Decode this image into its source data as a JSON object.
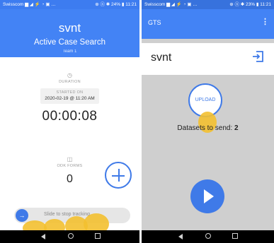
{
  "left": {
    "statusbar": {
      "carrier": "Swisscom",
      "icons": "▆ ◢ ⚡ ◔ ▣ …",
      "right": "⊕ ⓝ ✱ 24% ▮ 11:21"
    },
    "header": {
      "title": "svnt",
      "subtitle": "Active Case Search",
      "team": "Team 1"
    },
    "duration_icon": "◷",
    "duration_label": "DURATION",
    "started_label": "STARTED ON",
    "started_value": "2020-02-19 @ 11:20 AM",
    "timer": "00:00:08",
    "forms_icon": "◫",
    "forms_label": "ODK FORMS",
    "forms_count": "0",
    "fab_label": "+",
    "slider_arrow": "→",
    "slider_text": "Slide to stop tracking"
  },
  "right": {
    "statusbar": {
      "carrier": "Swisscom",
      "icons": "▆ ◢ ⚡ ◔ ▣ …",
      "right": "⊕ ⓝ ✱ 23% ▮ 11:21"
    },
    "appbar_title": "GTS",
    "appbar_menu": "⋮",
    "name": "svnt",
    "upload_label": "UPLOAD",
    "datasets_label": "Datasets to send:",
    "datasets_count": "2"
  },
  "colors": {
    "primary": "#4383f5",
    "accent": "#3f7ae8",
    "touch": "#f3c030"
  }
}
